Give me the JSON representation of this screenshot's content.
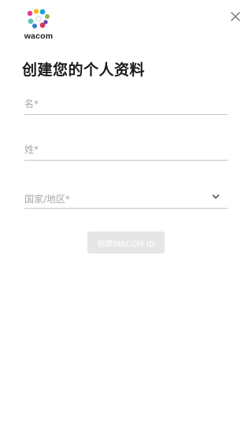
{
  "brand": {
    "logo_text": "wacom"
  },
  "header": {
    "close_icon": "close-icon"
  },
  "page": {
    "title": "创建您的个人资料"
  },
  "form": {
    "first_name": {
      "value": "",
      "placeholder": "名*"
    },
    "last_name": {
      "value": "",
      "placeholder": "姓*"
    },
    "country": {
      "selected": "国家/地区*",
      "icon": "chevron-down-icon"
    },
    "submit_label": "创建WACOM ID"
  },
  "colors": {
    "button_disabled_bg": "#e6e6e6",
    "underline": "#c4c4c4",
    "placeholder": "#a7a7a7"
  }
}
